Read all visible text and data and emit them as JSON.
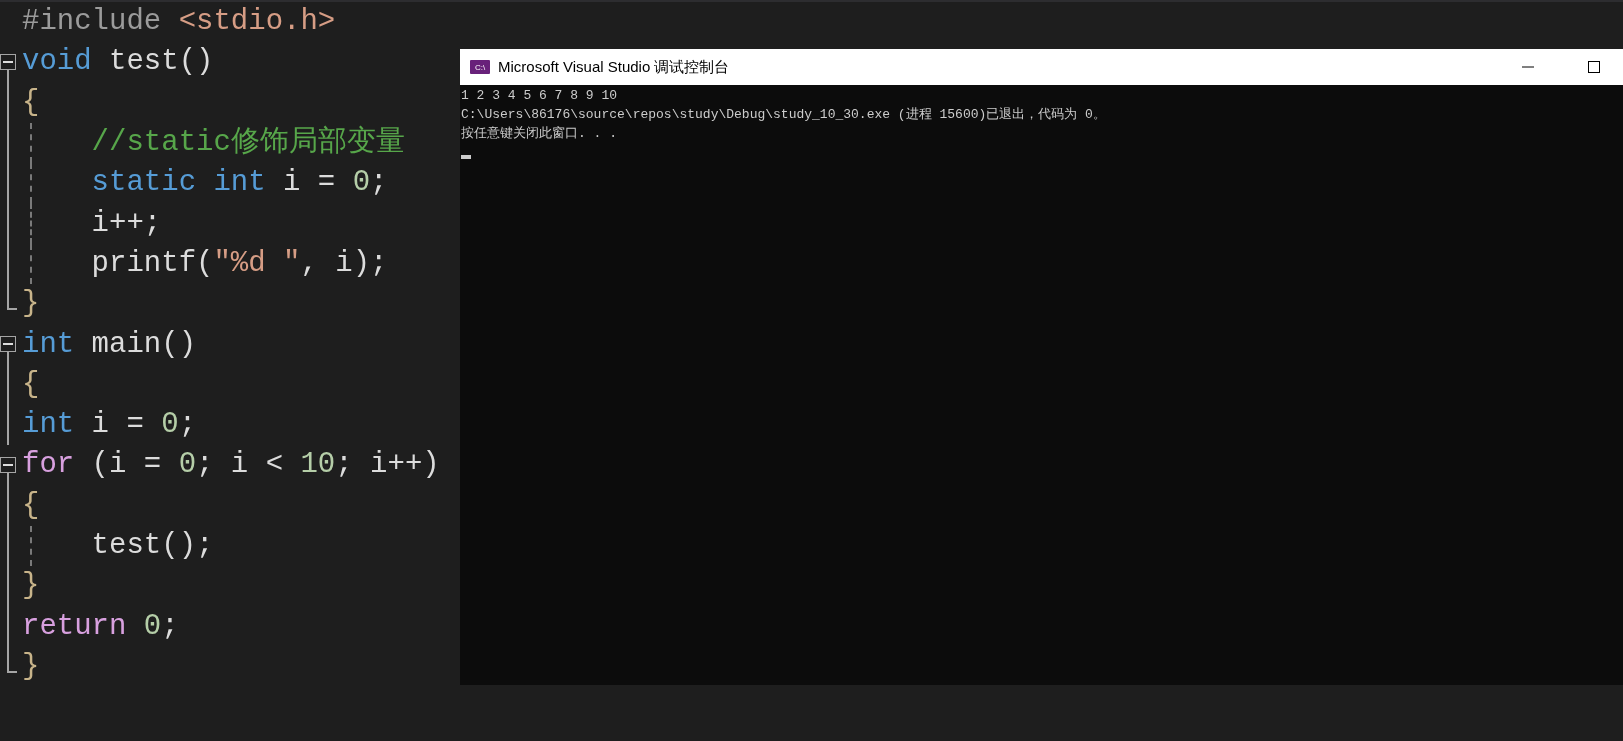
{
  "editor": {
    "lines": [
      {
        "kind": "none",
        "tokens": [
          {
            "text": "#include ",
            "kind": "preprocessor"
          },
          {
            "text": "<stdio.h>",
            "kind": "string"
          }
        ]
      },
      {
        "kind": "start",
        "tokens": [
          {
            "text": "void",
            "kind": "keyword"
          },
          {
            "text": " test()",
            "kind": "text"
          }
        ]
      },
      {
        "kind": "line",
        "tokens": [
          {
            "text": "{",
            "kind": "brace"
          }
        ]
      },
      {
        "kind": "inner",
        "tokens": [
          {
            "text": "    //static修饰局部变量",
            "kind": "comment"
          }
        ]
      },
      {
        "kind": "inner",
        "tokens": [
          {
            "text": "    static int",
            "kind": "keyword"
          },
          {
            "text": " i = ",
            "kind": "text"
          },
          {
            "text": "0",
            "kind": "number"
          },
          {
            "text": ";",
            "kind": "text"
          }
        ]
      },
      {
        "kind": "inner",
        "tokens": [
          {
            "text": "    i++;",
            "kind": "text"
          }
        ]
      },
      {
        "kind": "inner",
        "tokens": [
          {
            "text": "    printf(",
            "kind": "text"
          },
          {
            "text": "\"%d \"",
            "kind": "string"
          },
          {
            "text": ", i);",
            "kind": "text"
          }
        ]
      },
      {
        "kind": "end",
        "tokens": [
          {
            "text": "}",
            "kind": "brace"
          }
        ]
      },
      {
        "kind": "start",
        "tokens": [
          {
            "text": "int",
            "kind": "keyword"
          },
          {
            "text": " main()",
            "kind": "text"
          }
        ]
      },
      {
        "kind": "line",
        "tokens": [
          {
            "text": "{",
            "kind": "brace"
          }
        ]
      },
      {
        "kind": "line",
        "tokens": [
          {
            "text": "int",
            "kind": "keyword"
          },
          {
            "text": " i = ",
            "kind": "text"
          },
          {
            "text": "0",
            "kind": "number"
          },
          {
            "text": ";",
            "kind": "text"
          }
        ]
      },
      {
        "kind": "start",
        "tokens": [
          {
            "text": "for",
            "kind": "control"
          },
          {
            "text": " (i = ",
            "kind": "text"
          },
          {
            "text": "0",
            "kind": "number"
          },
          {
            "text": "; i < ",
            "kind": "text"
          },
          {
            "text": "10",
            "kind": "number"
          },
          {
            "text": "; i++)",
            "kind": "text"
          }
        ]
      },
      {
        "kind": "line",
        "tokens": [
          {
            "text": "{",
            "kind": "brace"
          }
        ]
      },
      {
        "kind": "inner",
        "tokens": [
          {
            "text": "    test();",
            "kind": "text"
          }
        ]
      },
      {
        "kind": "line",
        "tokens": [
          {
            "text": "}",
            "kind": "brace"
          }
        ]
      },
      {
        "kind": "line",
        "tokens": [
          {
            "text": "return ",
            "kind": "control"
          },
          {
            "text": "0",
            "kind": "number"
          },
          {
            "text": ";",
            "kind": "text"
          }
        ]
      },
      {
        "kind": "end",
        "tokens": [
          {
            "text": "}",
            "kind": "brace"
          }
        ]
      }
    ]
  },
  "console": {
    "title": "Microsoft Visual Studio 调试控制台",
    "icon_text": "C:\\",
    "output": [
      "1 2 3 4 5 6 7 8 9 10",
      "C:\\Users\\86176\\source\\repos\\study\\Debug\\study_10_30.exe (进程 15600)已退出，代码为 0。",
      "按任意键关闭此窗口. . ."
    ]
  }
}
